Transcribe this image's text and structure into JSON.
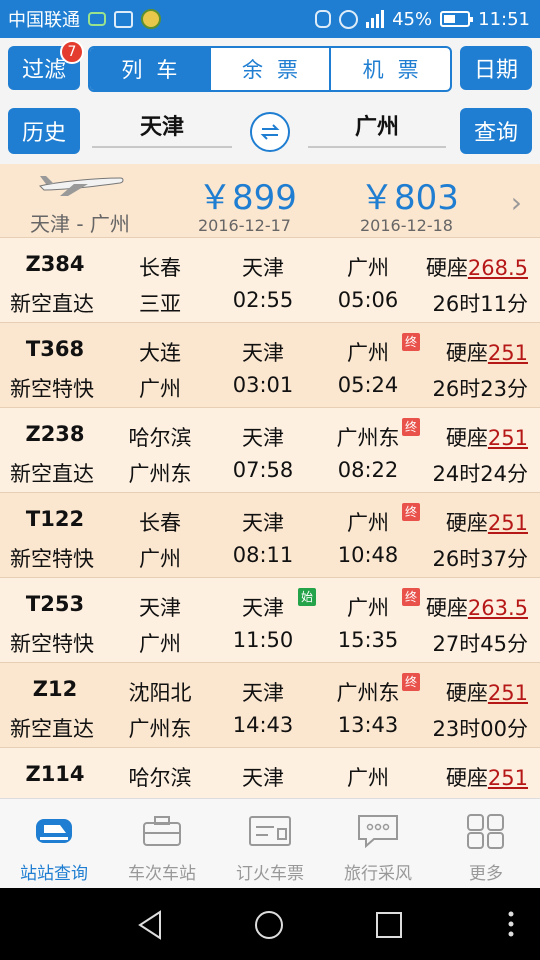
{
  "status_bar": {
    "carrier": "中国联通",
    "battery": "45%",
    "time": "11:51"
  },
  "top": {
    "filter_label": "过滤",
    "filter_badge": "7",
    "tabs": [
      {
        "label": "列车",
        "active": true
      },
      {
        "label": "余票",
        "active": false
      },
      {
        "label": "机票",
        "active": false
      }
    ],
    "date_label": "日期"
  },
  "search": {
    "history_label": "历史",
    "from_city": "天津",
    "to_city": "广州",
    "query_label": "查询"
  },
  "flight_banner": {
    "route": "天津 - 广州",
    "price_1": "￥899",
    "date_1": "2016-12-17",
    "price_2": "￥803",
    "date_2": "2016-12-18"
  },
  "trains": [
    {
      "number": "Z384",
      "type": "新空直达",
      "origin": "长春",
      "terminus": "三亚",
      "depart_station": "天津",
      "depart_tag": "",
      "depart_time": "02:55",
      "arrive_station": "广州",
      "arrive_tag": "",
      "arrive_time": "05:06",
      "seat": "硬座",
      "fare": "268.5",
      "duration": "26时11分"
    },
    {
      "number": "T368",
      "type": "新空特快",
      "origin": "大连",
      "terminus": "广州",
      "depart_station": "天津",
      "depart_tag": "",
      "depart_time": "03:01",
      "arrive_station": "广州",
      "arrive_tag": "终",
      "arrive_time": "05:24",
      "seat": "硬座",
      "fare": "251",
      "duration": "26时23分"
    },
    {
      "number": "Z238",
      "type": "新空直达",
      "origin": "哈尔滨",
      "terminus": "广州东",
      "depart_station": "天津",
      "depart_tag": "",
      "depart_time": "07:58",
      "arrive_station": "广州东",
      "arrive_tag": "终",
      "arrive_time": "08:22",
      "seat": "硬座",
      "fare": "251",
      "duration": "24时24分"
    },
    {
      "number": "T122",
      "type": "新空特快",
      "origin": "长春",
      "terminus": "广州",
      "depart_station": "天津",
      "depart_tag": "",
      "depart_time": "08:11",
      "arrive_station": "广州",
      "arrive_tag": "终",
      "arrive_time": "10:48",
      "seat": "硬座",
      "fare": "251",
      "duration": "26时37分"
    },
    {
      "number": "T253",
      "type": "新空特快",
      "origin": "天津",
      "terminus": "广州",
      "depart_station": "天津",
      "depart_tag": "始",
      "depart_time": "11:50",
      "arrive_station": "广州",
      "arrive_tag": "终",
      "arrive_time": "15:35",
      "seat": "硬座",
      "fare": "263.5",
      "duration": "27时45分"
    },
    {
      "number": "Z12",
      "type": "新空直达",
      "origin": "沈阳北",
      "terminus": "广州东",
      "depart_station": "天津",
      "depart_tag": "",
      "depart_time": "14:43",
      "arrive_station": "广州东",
      "arrive_tag": "终",
      "arrive_time": "13:43",
      "seat": "硬座",
      "fare": "251",
      "duration": "23时00分"
    },
    {
      "number": "Z114",
      "type": "",
      "origin": "哈尔滨",
      "terminus": "",
      "depart_station": "天津",
      "depart_tag": "",
      "depart_time": "",
      "arrive_station": "广州",
      "arrive_tag": "",
      "arrive_time": "",
      "seat": "硬座",
      "fare": "251",
      "duration": ""
    }
  ],
  "bottom_nav": [
    {
      "label": "站站查询",
      "icon": "train-icon",
      "active": true
    },
    {
      "label": "车次车站",
      "icon": "briefcase-icon",
      "active": false
    },
    {
      "label": "订火车票",
      "icon": "ticket-icon",
      "active": false
    },
    {
      "label": "旅行采风",
      "icon": "chat-bubble-icon",
      "active": false
    },
    {
      "label": "更多",
      "icon": "grid-icon",
      "active": false
    }
  ],
  "colors": {
    "primary": "#1f7ed1",
    "row_light": "#fdf0e1",
    "row_dark": "#fbe6cf",
    "fare": "#b61818",
    "end_tag": "#e8524a",
    "start_tag": "#25a34a"
  }
}
